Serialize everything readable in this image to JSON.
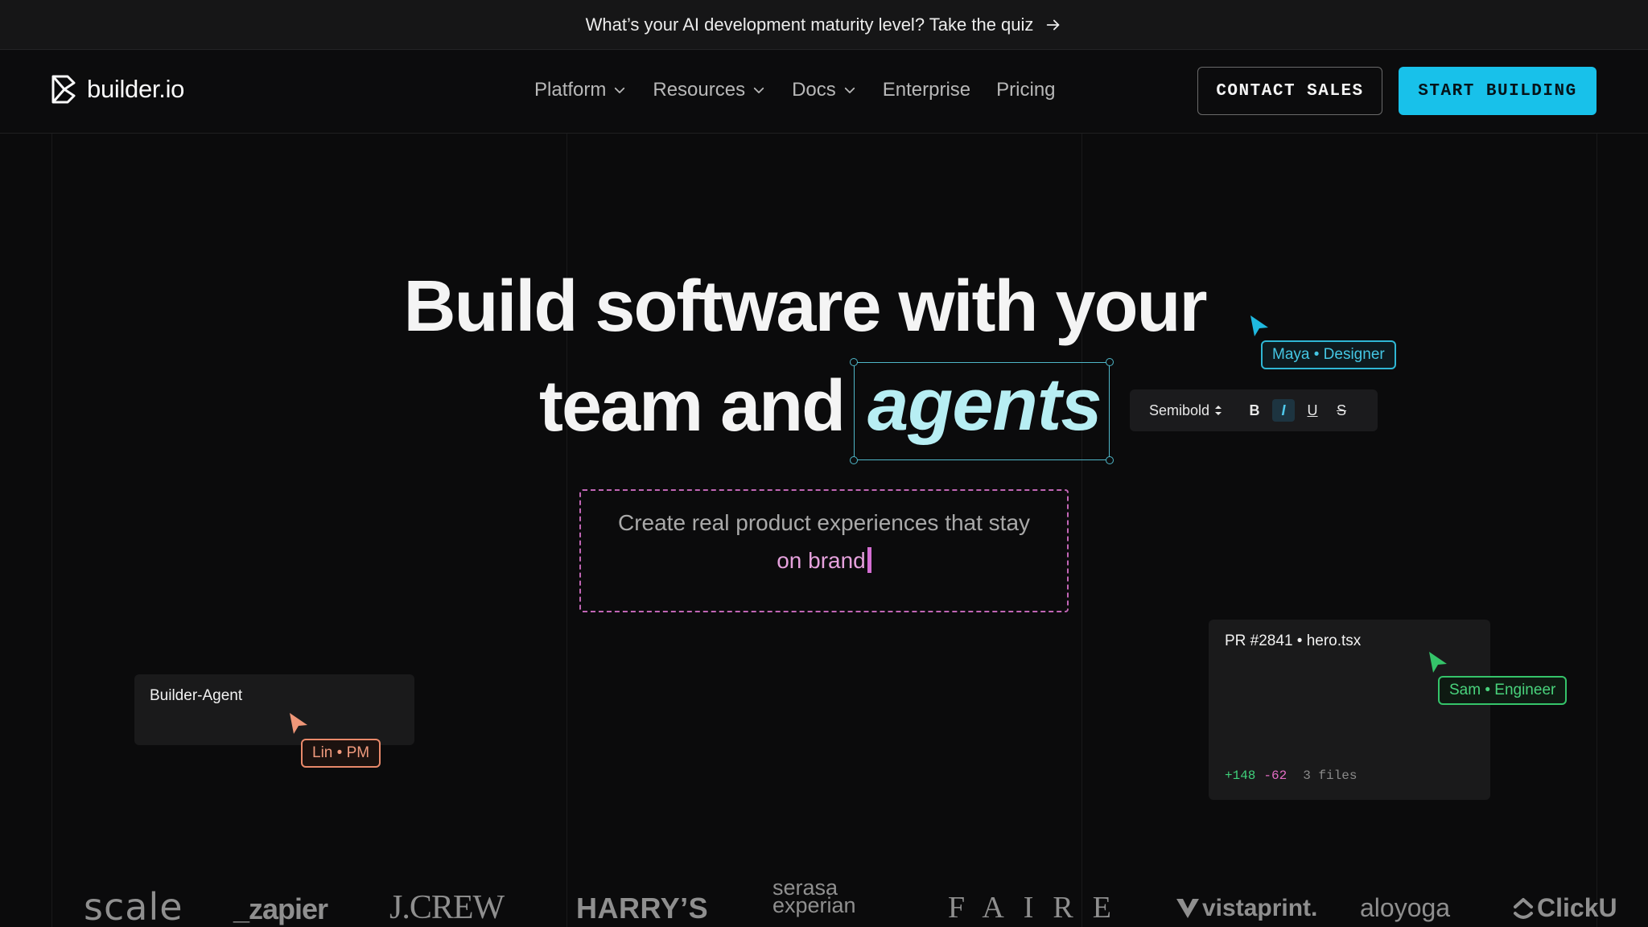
{
  "announcement": {
    "text": "What’s your AI development maturity level? Take the quiz"
  },
  "nav": {
    "brand": "builder.io",
    "menu": [
      {
        "label": "Platform",
        "has_dropdown": true
      },
      {
        "label": "Resources",
        "has_dropdown": true
      },
      {
        "label": "Docs",
        "has_dropdown": true
      },
      {
        "label": "Enterprise",
        "has_dropdown": false
      },
      {
        "label": "Pricing",
        "has_dropdown": false
      }
    ],
    "contact_label": "CONTACT SALES",
    "start_label": "START BUILDING"
  },
  "hero": {
    "line1": "Build software with your",
    "line2_prefix": "team and",
    "line2_highlight": "agents",
    "subtitle_1": "Create real product experiences that stay",
    "subtitle_2": "on brand"
  },
  "toolbar": {
    "font_weight": "Semibold",
    "bold": "B",
    "italic": "I",
    "underline": "U",
    "strike": "S"
  },
  "collaborators": {
    "maya": "Maya • Designer",
    "sam": "Sam • Engineer",
    "lin": "Lin • PM"
  },
  "cards": {
    "agent_title": "Builder-Agent",
    "pr_title": "PR #2841 • hero.tsx",
    "pr_additions": "+148",
    "pr_deletions": "-62",
    "pr_files": "3 files"
  },
  "logos": {
    "scale": "scale",
    "zapier": "_zapier",
    "jcrew": "J.CREW",
    "harrys": "HARRY’S",
    "serasa_1": "serasa",
    "serasa_2": "experian",
    "faire": "FAIRE",
    "vistaprint": "vistaprint.",
    "aloyoga": "aloyoga",
    "clickup": "ClickU"
  },
  "colors": {
    "accent_cyan": "#18c1ea",
    "maya": "#2fb7d4",
    "sam": "#35c46a",
    "lin": "#e9896a",
    "brand_text_pink": "#e5a1dc",
    "agents_text": "#b7eef3"
  },
  "icons": {
    "announce_arrow": "arrow-right-icon",
    "dropdown": "chevron-down-icon",
    "logo": "builder-logo-icon",
    "cursor": "pointer-cursor-icon"
  }
}
